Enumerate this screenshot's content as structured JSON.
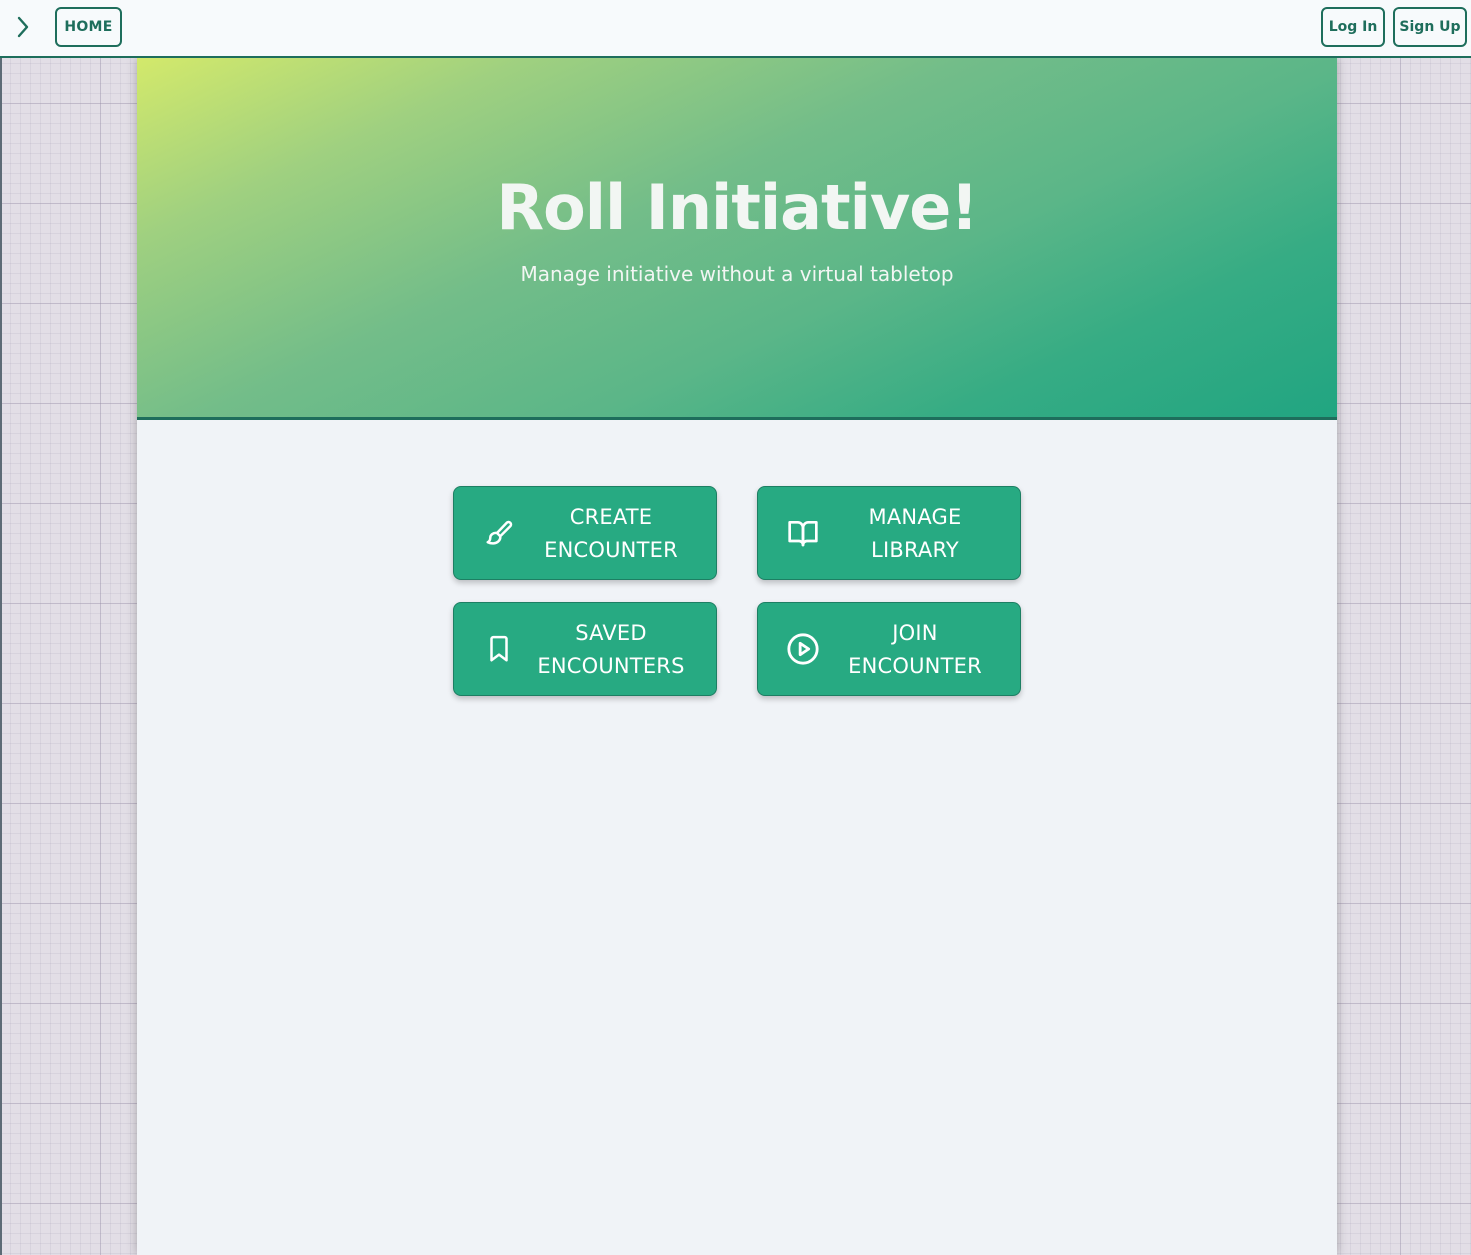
{
  "navbar": {
    "toggle_icon": "chevron-right-icon",
    "home_label": "HOME",
    "login_label": "Log In",
    "signup_label": "Sign Up"
  },
  "hero": {
    "title": "Roll Initiative!",
    "subtitle": "Manage initiative without a virtual tabletop"
  },
  "actions": [
    {
      "icon": "paintbrush-icon",
      "line1": "CREATE",
      "line2": "ENCOUNTER"
    },
    {
      "icon": "book-icon",
      "line1": "MANAGE",
      "line2": "LIBRARY"
    },
    {
      "icon": "bookmark-icon",
      "line1": "SAVED",
      "line2": "ENCOUNTERS"
    },
    {
      "icon": "play-circle-icon",
      "line1": "JOIN",
      "line2": "ENCOUNTER"
    }
  ],
  "colors": {
    "accent": "#27aa82",
    "dark_accent": "#1e6e5c",
    "hero_gradient_start": "#d3e96b",
    "hero_gradient_end": "#21a581",
    "panel_background": "#f0f3f7"
  }
}
